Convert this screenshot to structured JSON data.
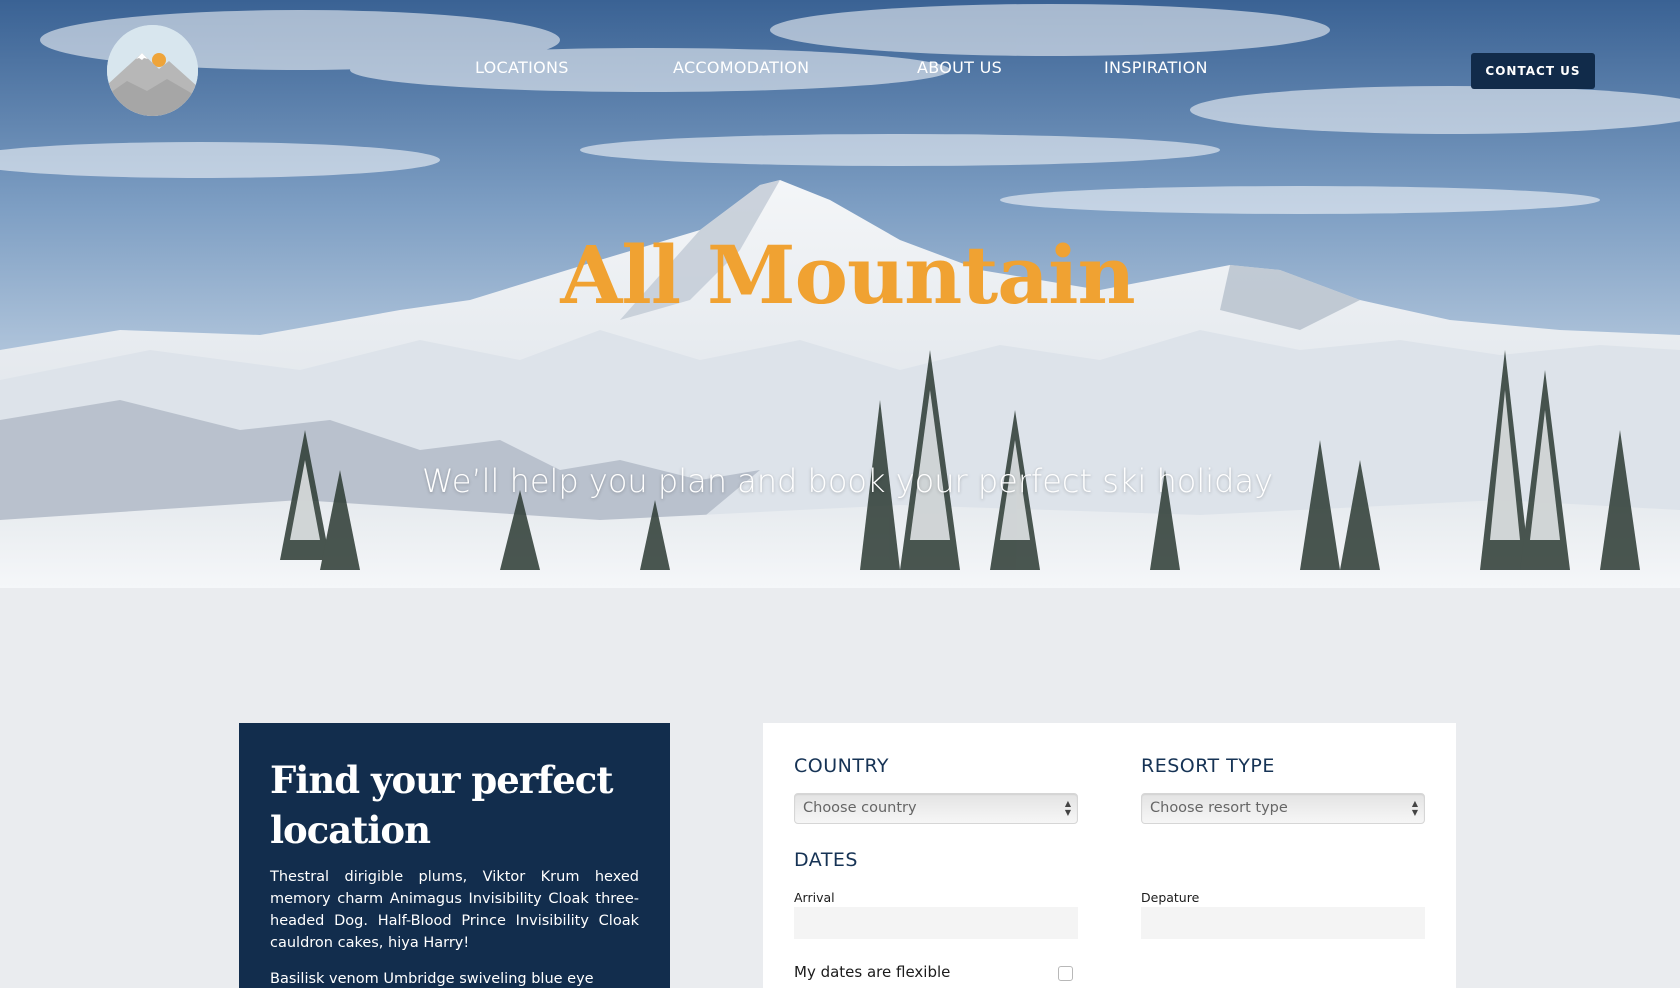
{
  "nav": {
    "items": [
      {
        "label": "LOCATIONS"
      },
      {
        "label": "ACCOMODATION"
      },
      {
        "label": "ABOUT US"
      },
      {
        "label": "INSPIRATION"
      }
    ],
    "contact_label": "CONTACT US"
  },
  "hero": {
    "title": "All Mountain",
    "subtitle": "We’ll help you plan and book your perfect ski holiday"
  },
  "find": {
    "heading_line1": "Find your perfect",
    "heading_line2": "location",
    "paragraph1": "Thestral dirigible plums, Viktor Krum hexed memory charm Animagus Invisibility Cloak three-headed Dog. Half-Blood Prince Invisibility Cloak cauldron cakes, hiya Harry!",
    "paragraph2": "Basilisk venom Umbridge swiveling blue eye"
  },
  "form": {
    "country_label": "COUNTRY",
    "country_placeholder": "Choose country",
    "resort_label": "RESORT TYPE",
    "resort_placeholder": "Choose resort type",
    "dates_label": "DATES",
    "arrival_label": "Arrival",
    "departure_label": "Depature",
    "flexible_label": "My dates are flexible"
  },
  "colors": {
    "accent": "#f0a232",
    "navy": "#122d4d",
    "background": "#eaecef"
  },
  "icons": [
    "mountain-logo-icon",
    "select-arrows-icon"
  ]
}
